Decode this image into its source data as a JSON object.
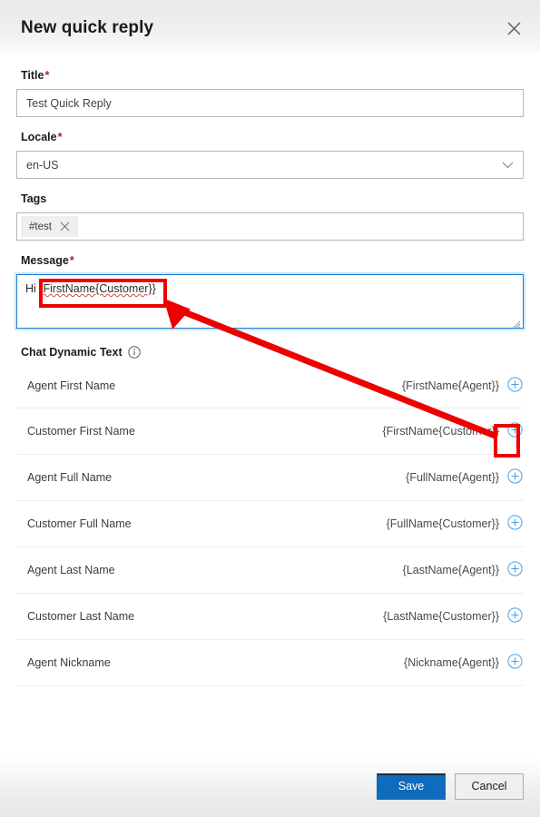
{
  "dialog": {
    "title": "New quick reply",
    "close_icon": "close-icon"
  },
  "form": {
    "title_field": {
      "label": "Title",
      "required_marker": "*",
      "value": "Test Quick Reply",
      "placeholder": ""
    },
    "locale_field": {
      "label": "Locale",
      "required_marker": "*",
      "value": "en-US",
      "chevron_icon": "chevron-down-icon"
    },
    "tags_field": {
      "label": "Tags",
      "chips": [
        {
          "label": "#test",
          "remove_icon": "close-icon"
        }
      ]
    },
    "message_field": {
      "label": "Message",
      "required_marker": "*",
      "prefix": "Hi ",
      "token": "{FirstName{Customer}}",
      "value": "Hi {FirstName{Customer}}"
    }
  },
  "dynamic_text": {
    "heading": "Chat Dynamic Text",
    "info_icon": "info-icon",
    "add_icon": "plus-circle-icon",
    "rows": [
      {
        "name": "Agent First Name",
        "value": "{FirstName{Agent}}"
      },
      {
        "name": "Customer First Name",
        "value": "{FirstName{Customer}}"
      },
      {
        "name": "Agent Full Name",
        "value": "{FullName{Agent}}"
      },
      {
        "name": "Customer Full Name",
        "value": "{FullName{Customer}}"
      },
      {
        "name": "Agent Last Name",
        "value": "{LastName{Agent}}"
      },
      {
        "name": "Customer Last Name",
        "value": "{LastName{Customer}}"
      },
      {
        "name": "Agent Nickname",
        "value": "{Nickname{Agent}}"
      }
    ]
  },
  "footer": {
    "save_label": "Save",
    "cancel_label": "Cancel"
  },
  "colors": {
    "accent_blue": "#0f6cbd",
    "focus_border": "#1f7fd4",
    "required_red": "#a4262c",
    "annotation_red": "#ee0000",
    "add_icon_blue": "#4a9fe0"
  }
}
